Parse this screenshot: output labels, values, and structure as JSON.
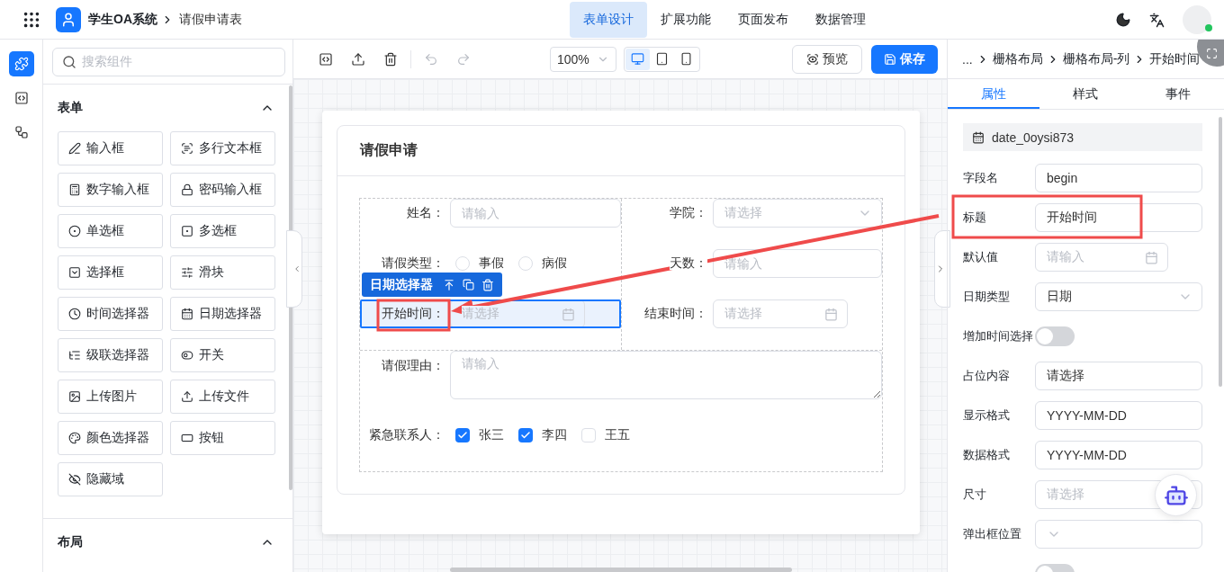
{
  "topbar": {
    "app_name": "学生OA系统",
    "page": "请假申请表",
    "nav": [
      {
        "label": "表单设计",
        "selected": true
      },
      {
        "label": "扩展功能",
        "selected": false
      },
      {
        "label": "页面发布",
        "selected": false
      },
      {
        "label": "数据管理",
        "selected": false
      }
    ]
  },
  "rail": [
    {
      "selected": true
    },
    {
      "selected": false
    },
    {
      "selected": false
    }
  ],
  "palette": {
    "search_placeholder": "搜索组件",
    "sections": [
      {
        "title": "表单",
        "expanded": true,
        "items": [
          {
            "label": "输入框"
          },
          {
            "label": "多行文本框"
          },
          {
            "label": "数字输入框"
          },
          {
            "label": "密码输入框"
          },
          {
            "label": "单选框"
          },
          {
            "label": "多选框"
          },
          {
            "label": "选择框"
          },
          {
            "label": "滑块"
          },
          {
            "label": "时间选择器"
          },
          {
            "label": "日期选择器"
          },
          {
            "label": "级联选择器"
          },
          {
            "label": "开关"
          },
          {
            "label": "上传图片"
          },
          {
            "label": "上传文件"
          },
          {
            "label": "颜色选择器"
          },
          {
            "label": "按钮"
          },
          {
            "label": "隐藏域"
          }
        ]
      },
      {
        "title": "布局",
        "expanded": true
      }
    ]
  },
  "toolbar": {
    "tools": [
      {
        "disabled": false
      },
      {
        "disabled": false
      },
      {
        "disabled": false
      },
      {
        "disabled": true
      },
      {
        "disabled": true
      }
    ],
    "zoom": "100%",
    "devices": [
      {
        "selected": true
      },
      {
        "selected": false
      },
      {
        "selected": false
      }
    ],
    "preview": "预览",
    "save": "保存"
  },
  "form": {
    "title": "请假申请",
    "selected_tag": "日期选择器",
    "grid": [
      [
        {
          "label": "姓名：",
          "kind": "input",
          "placeholder": "请输入",
          "selected": false
        },
        {
          "label": "请假类型：",
          "kind": "radio",
          "selected": false,
          "options": [
            {
              "label": "事假",
              "selected": false
            },
            {
              "label": "病假",
              "selected": false
            }
          ]
        },
        {
          "label": "开始时间：",
          "kind": "date",
          "placeholder": "请选择",
          "selected": true
        }
      ],
      [
        {
          "label": "学院：",
          "kind": "select",
          "placeholder": "请选择",
          "selected": false
        },
        {
          "label": "天数：",
          "kind": "input",
          "placeholder": "请输入",
          "selected": false
        },
        {
          "label": "结束时间：",
          "kind": "date",
          "placeholder": "请选择",
          "selected": false
        }
      ]
    ],
    "rows": [
      {
        "label": "请假理由：",
        "kind": "textarea",
        "placeholder": "请输入",
        "selected": false
      },
      {
        "label": "紧急联系人：",
        "kind": "checkbox",
        "selected": false,
        "options": [
          {
            "label": "张三",
            "checked": true
          },
          {
            "label": "李四",
            "checked": true
          },
          {
            "label": "王五",
            "checked": false
          }
        ]
      }
    ]
  },
  "inspector": {
    "path": [
      "...",
      "栅格布局",
      "栅格布局-列",
      "开始时间"
    ],
    "tabs": [
      {
        "label": "属性",
        "selected": true
      },
      {
        "label": "样式",
        "selected": false
      },
      {
        "label": "事件",
        "selected": false
      }
    ],
    "component_id": "date_0oysi873",
    "props": [
      {
        "label": "字段名",
        "kind": "input",
        "value": "begin"
      },
      {
        "label": "标题",
        "kind": "input",
        "value": "开始时间"
      },
      {
        "label": "默认值",
        "kind": "date",
        "placeholder": "请输入"
      },
      {
        "label": "日期类型",
        "kind": "select",
        "value": "日期"
      },
      {
        "label": "增加时间选择",
        "kind": "switch",
        "on": false
      },
      {
        "label": "占位内容",
        "kind": "input",
        "value": "请选择"
      },
      {
        "label": "显示格式",
        "kind": "input",
        "value": "YYYY-MM-DD"
      },
      {
        "label": "数据格式",
        "kind": "input",
        "value": "YYYY-MM-DD"
      },
      {
        "label": "尺寸",
        "kind": "select",
        "placeholder": "请选择"
      },
      {
        "label": "弹出框位置",
        "kind": "select"
      },
      {
        "kind": "switch",
        "on": false
      }
    ]
  }
}
